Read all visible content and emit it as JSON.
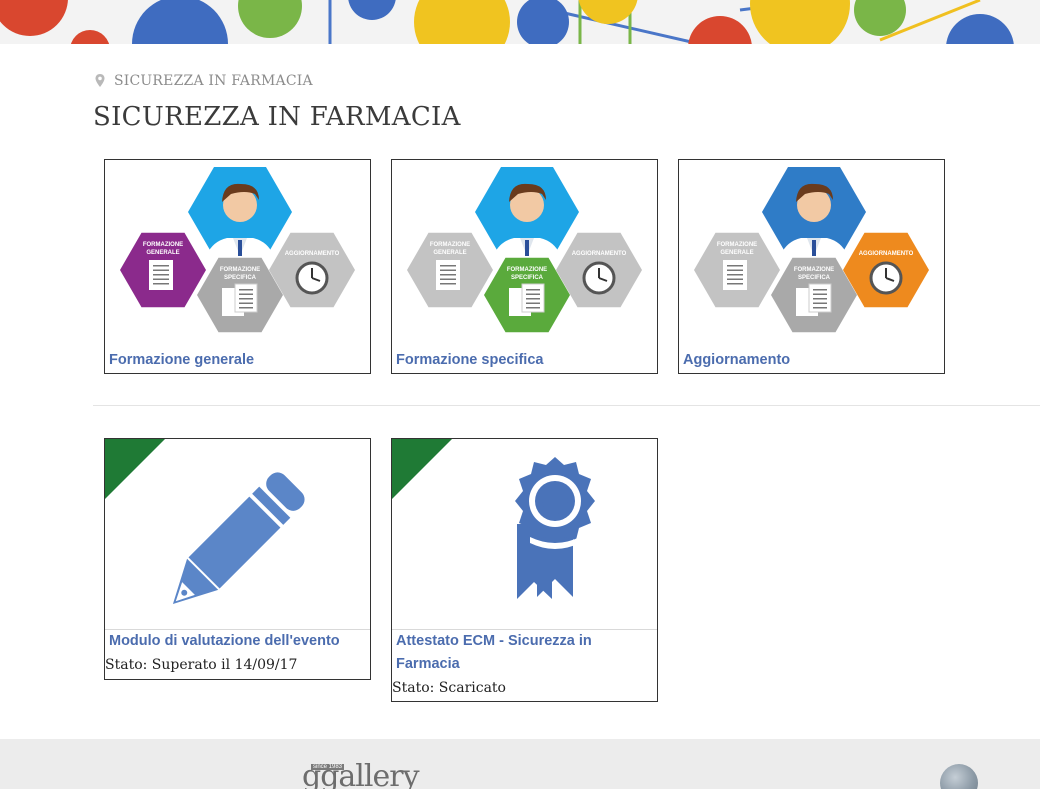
{
  "breadcrumb": {
    "label": "SICUREZZA IN FARMACIA"
  },
  "page": {
    "title": "SICUREZZA IN FARMACIA"
  },
  "modules": [
    {
      "caption": "Formazione generale",
      "highlight": "formazione-generale",
      "highlight_color": "#8b2a8c"
    },
    {
      "caption": "Formazione specifica",
      "highlight": "formazione-specifica",
      "highlight_color": "#5aaa3c"
    },
    {
      "caption": "Aggiornamento",
      "highlight": "aggiornamento",
      "highlight_color": "#ee8a1e"
    }
  ],
  "hex_labels": {
    "generale_1": "FORMAZIONE",
    "generale_2": "GENERALE",
    "specifica_1": "FORMAZIONE",
    "specifica_2": "SPECIFICA",
    "aggiornamento": "AGGIORNAMENTO"
  },
  "activities": [
    {
      "caption": "Modulo di valutazione dell'evento",
      "status": "Stato: Superato il 14/09/17",
      "icon": "pencil-icon"
    },
    {
      "caption_line1": "Attestato ECM - Sicurezza in",
      "caption_line2": "Farmacia",
      "status": "Stato: Scaricato",
      "icon": "award-ribbon-icon"
    }
  ],
  "footer": {
    "logo": "ggallery",
    "since": "since 1983"
  },
  "colors": {
    "accent": "#4b6cae",
    "completed_corner": "#1f7a35",
    "icon_blue": "#5b86c8"
  }
}
